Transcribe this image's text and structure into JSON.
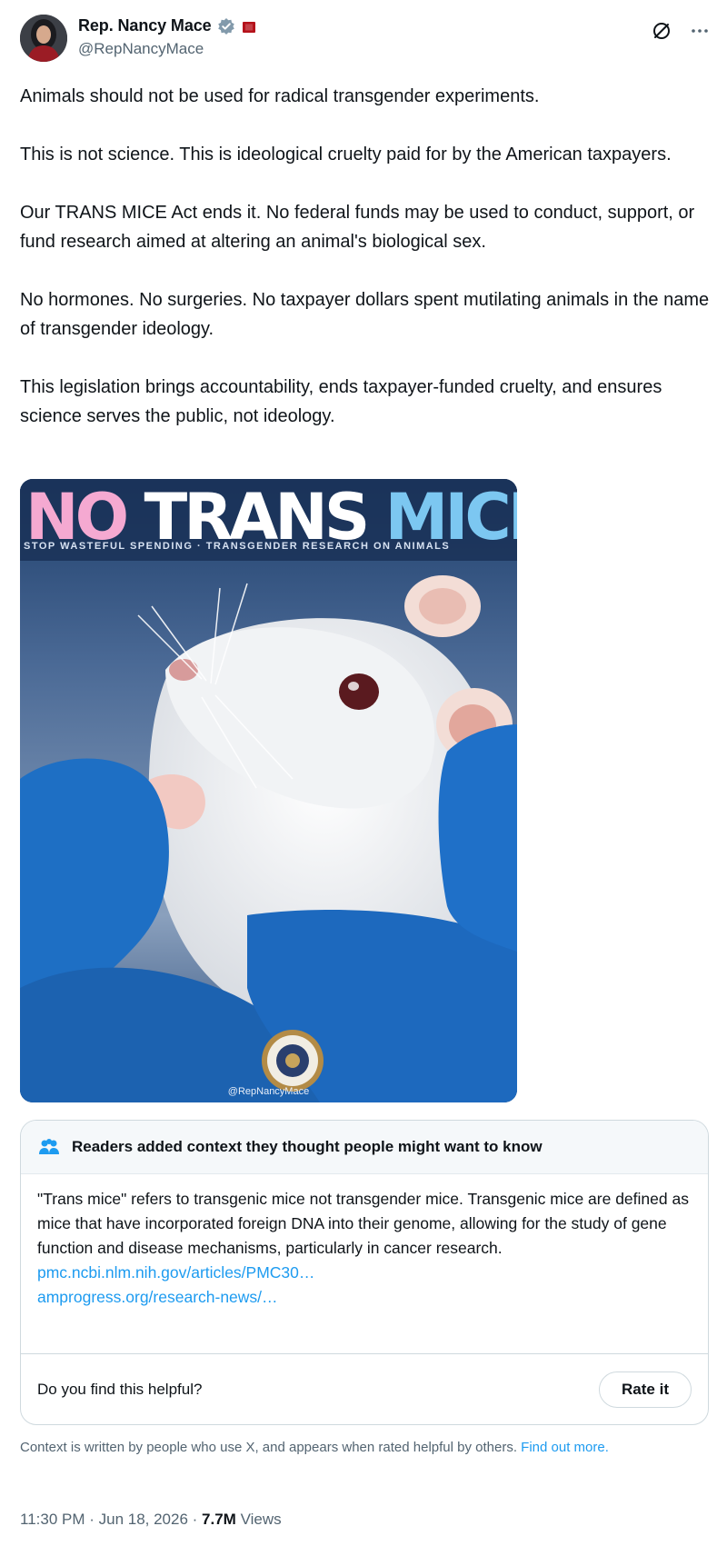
{
  "author": {
    "display_name": "Rep. Nancy Mace",
    "handle": "@RepNancyMace"
  },
  "header_icons": [
    "verified-badge-icon",
    "government-flag-icon",
    "grok-icon",
    "more-icon"
  ],
  "tweet": {
    "paragraphs": [
      "Animals should not be used for radical transgender experiments.",
      "This is not science. This is ideological cruelty paid for by the American taxpayers.",
      "Our TRANS MICE Act ends it. No federal funds may be used to conduct, support, or fund research aimed at altering an animal's biological sex.",
      "No hormones. No surgeries. No taxpayer dollars spent mutilating animals in the name of transgender ideology.",
      "This legislation brings accountability, ends taxpayer-funded cruelty, and ensures science serves the public, not ideology."
    ]
  },
  "media": {
    "title_no": "NO",
    "title_trans": "TRANS",
    "title_mice": "MICE",
    "subtitle": "STOP WASTEFUL SPENDING · TRANSGENDER RESEARCH ON ANIMALS",
    "watermark": "@RepNancyMace",
    "colors": {
      "pink": "#f5a9d1",
      "white": "#ffffff",
      "blue": "#7cc7f1",
      "background": "#27476f",
      "glove": "#1e6fc4"
    }
  },
  "community_note": {
    "header": "Readers added context they thought people might want to know",
    "body": "\"Trans mice\" refers to transgenic mice not transgender mice. Transgenic mice are defined as mice that have incorporated foreign DNA into their genome, allowing for the study of gene function and disease mechanisms, particularly in cancer research.",
    "links": [
      "pmc.ncbi.nlm.nih.gov/articles/PMC30…",
      "amprogress.org/research-news/…"
    ],
    "helpful_question": "Do you find this helpful?",
    "rate_button": "Rate it"
  },
  "disclaimer": {
    "text": "Context is written by people who use X, and appears when rated helpful by others.",
    "link": "Find out more."
  },
  "meta": {
    "time_date": "11:30 PM · Jun 18, 2026 ·",
    "views_count": "7.7M",
    "views_label": "Views"
  },
  "colors": {
    "accent": "#1d9bf0",
    "secondary_text": "#536471",
    "border": "#cfd9de"
  }
}
